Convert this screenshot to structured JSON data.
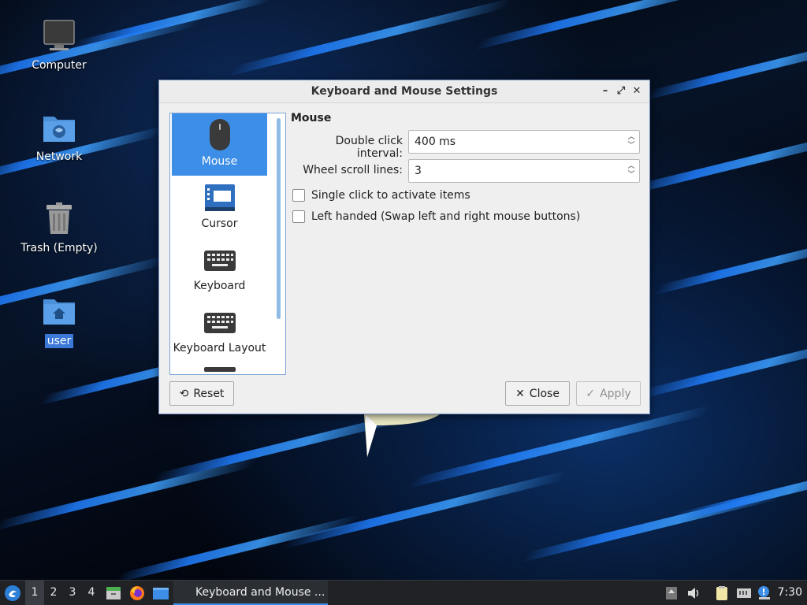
{
  "desktop": {
    "icons": [
      {
        "label": "Computer"
      },
      {
        "label": "Network"
      },
      {
        "label": "Trash (Empty)"
      },
      {
        "label": "user"
      }
    ]
  },
  "window": {
    "title": "Keyboard and Mouse Settings",
    "controls": {
      "minimize": "–",
      "maximize": "⤢",
      "close": "✕"
    },
    "sidebar": {
      "items": [
        {
          "label": "Mouse",
          "icon": "mouse-icon",
          "active": true
        },
        {
          "label": "Cursor",
          "icon": "cursor-window-icon"
        },
        {
          "label": "Keyboard",
          "icon": "keyboard-icon"
        },
        {
          "label": "Keyboard Layout",
          "icon": "keyboard-layout-icon"
        }
      ]
    },
    "content": {
      "section_title": "Mouse",
      "double_click_label": "Double click interval:",
      "double_click_value": "400 ms",
      "wheel_scroll_label": "Wheel scroll lines:",
      "wheel_scroll_value": "3",
      "single_click_label": "Single click to activate items",
      "left_handed_label": "Left handed (Swap left and right mouse buttons)"
    },
    "buttons": {
      "reset": "Reset",
      "close": "Close",
      "apply": "Apply"
    }
  },
  "taskbar": {
    "workspaces": [
      "1",
      "2",
      "3",
      "4"
    ],
    "active_workspace": "1",
    "task_label": "Keyboard and Mouse ...",
    "clock": "7:30"
  },
  "colors": {
    "accent": "#3d8ee6",
    "taskbar_bg": "#202226",
    "window_bg": "#efefef"
  }
}
